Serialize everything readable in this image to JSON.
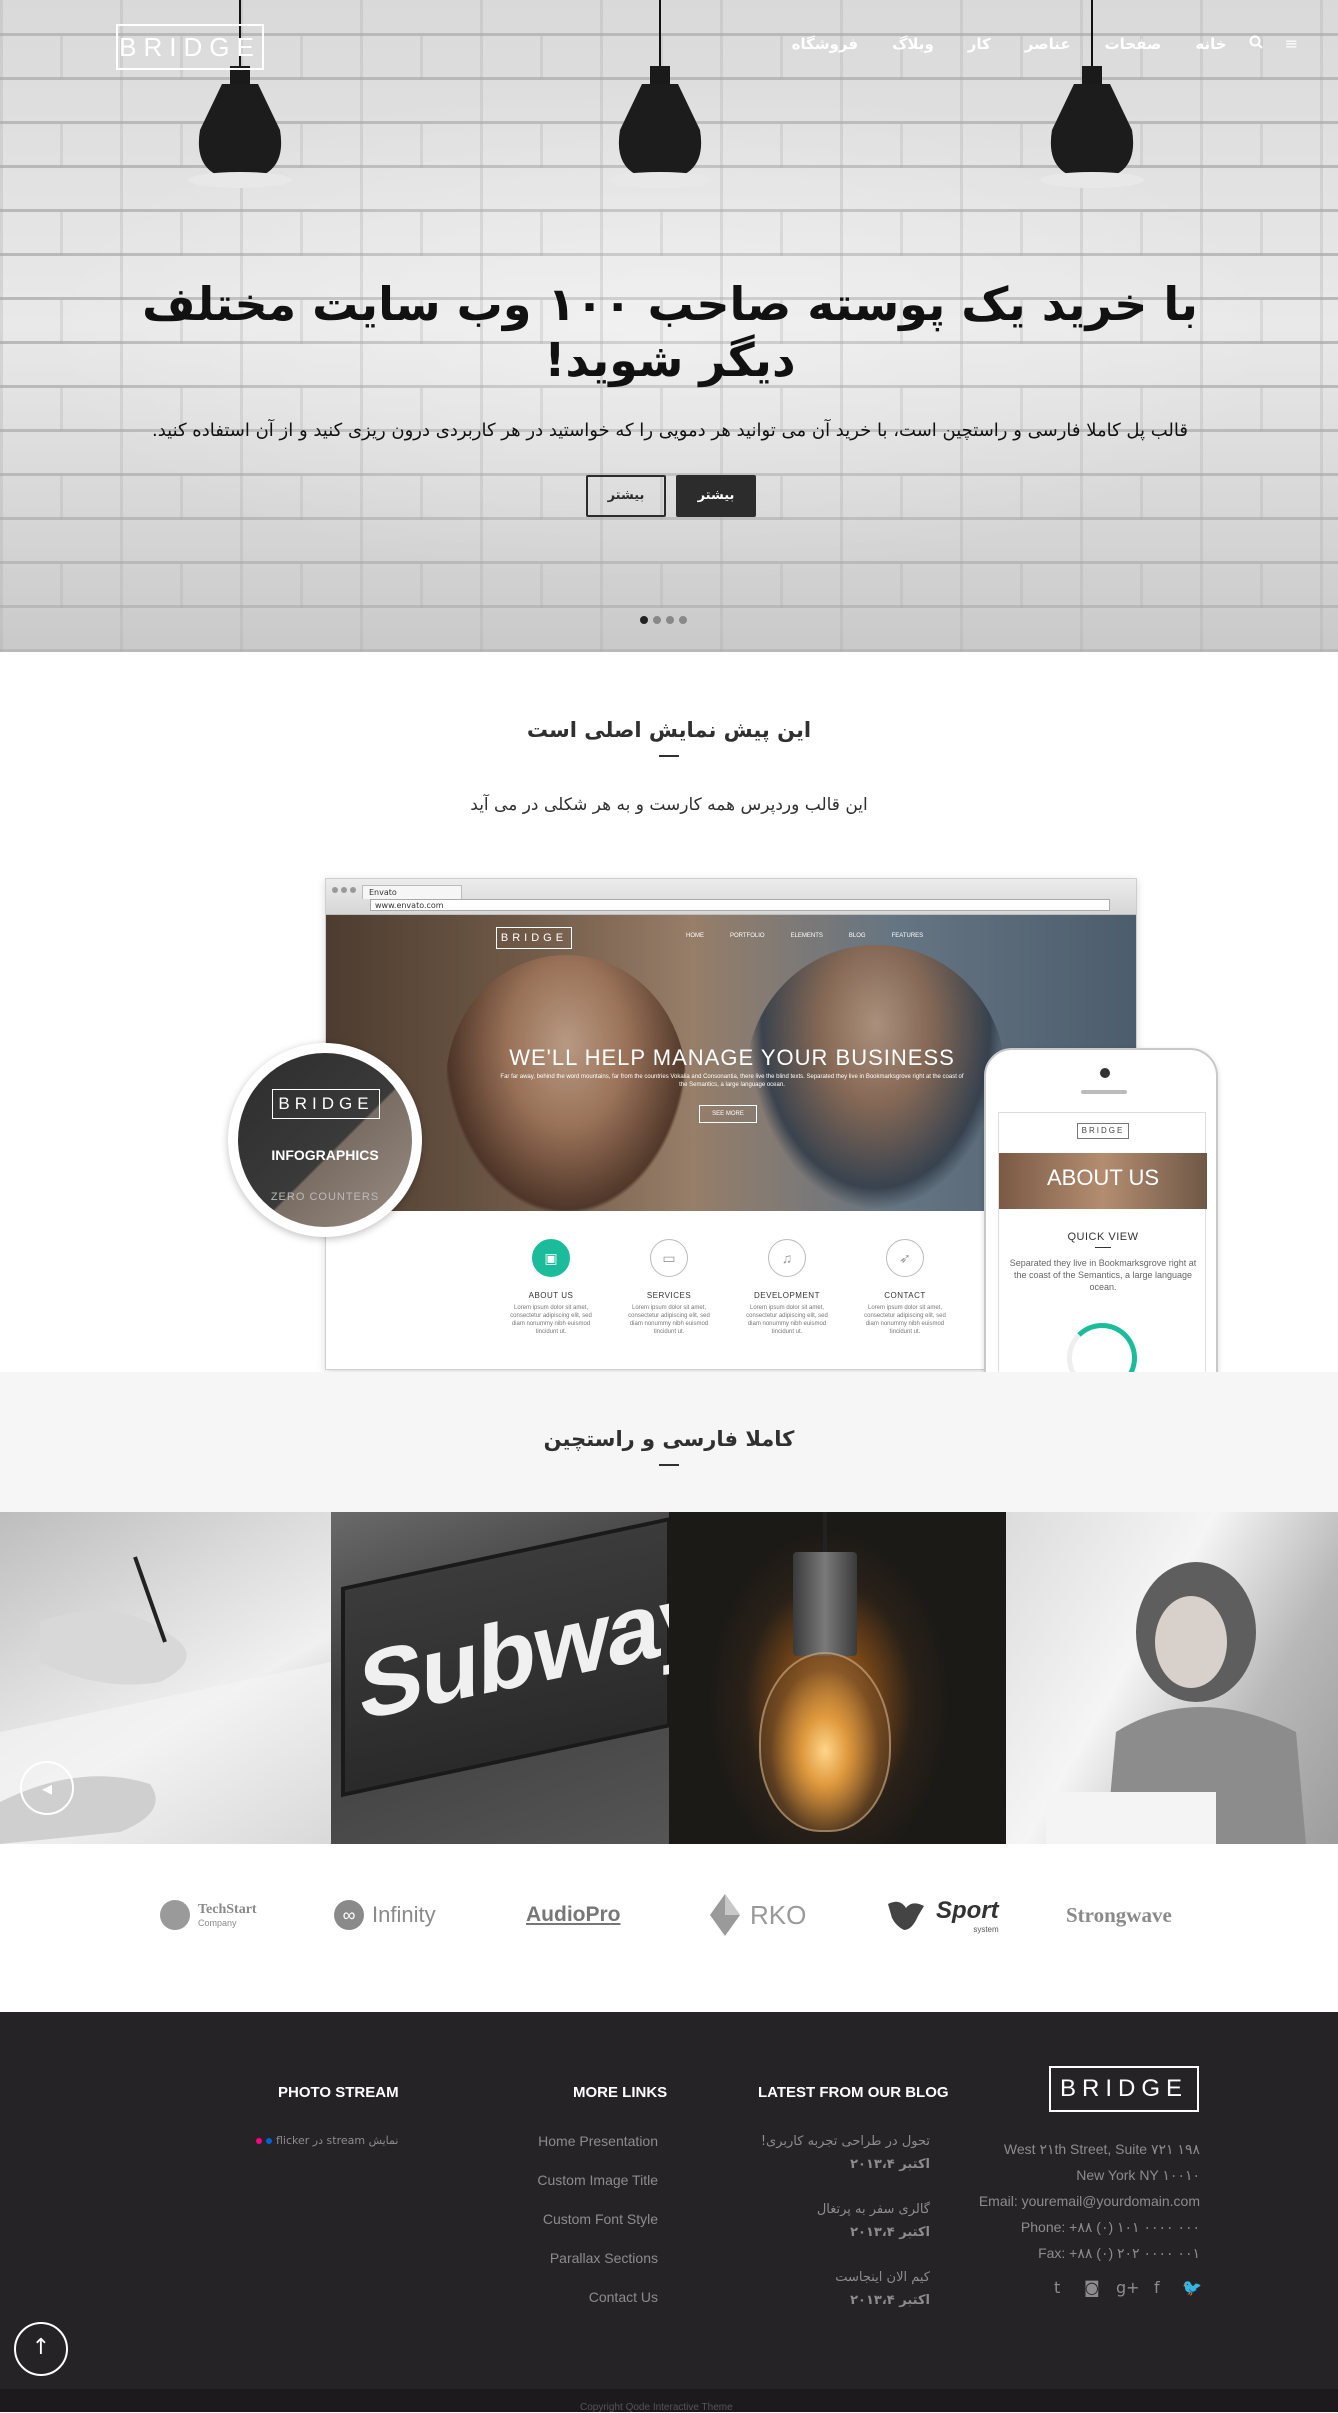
{
  "hero": {
    "logo": "BRIDGE",
    "nav": [
      "خانه",
      "صفحات",
      "عناصر",
      "کار",
      "وبلاگ",
      "فروشگاه"
    ],
    "title": "با خرید یک پوسته صاحب ۱۰۰ وب سایت مختلف دیگر شوید!",
    "subtitle": "قالب پل کاملا فارسی و راستچین است، با خرید آن می توانید هر دمویی را که خواستید در هر کاربردی درون ریزی کنید و از آن استفاده کنید.",
    "buttons": {
      "primary": "بیشتر",
      "secondary": "بیشتر"
    },
    "slides": 4,
    "active_slide": 1
  },
  "section_demo": {
    "title": "این پیش نمایش اصلی است",
    "subtitle": "این قالب وردپرس همه کارست و به هر شکلی در می آید"
  },
  "mockup": {
    "tab_label": "Envato",
    "url": "www.envato.com",
    "logo": "BRIDGE",
    "nav": [
      "HOME",
      "PORTFOLIO",
      "ELEMENTS",
      "BLOG",
      "FEATURES"
    ],
    "headline": "WE'LL HELP MANAGE YOUR BUSINESS",
    "text": "Far far away, behind the word mountains, far from the countries Vokalia and Consonantia, there live the blind texts. Separated they live in Bookmarksgrove right at the coast of the Semantics, a large language ocean.",
    "button": "SEE MORE",
    "services": [
      {
        "label": "ABOUT US",
        "text": "Lorem ipsum dolor sit amet, consectetur adipiscing elit, sed diam nonummy nibh euismod tincidunt ut."
      },
      {
        "label": "SERVICES",
        "text": "Lorem ipsum dolor sit amet, consectetur adipiscing elit, sed diam nonummy nibh euismod tincidunt ut."
      },
      {
        "label": "DEVELOPMENT",
        "text": "Lorem ipsum dolor sit amet, consectetur adipiscing elit, sed diam nonummy nibh euismod tincidunt ut."
      },
      {
        "label": "CONTACT",
        "text": "Lorem ipsum dolor sit amet, consectetur adipiscing elit, sed diam nonummy nibh euismod tincidunt ut."
      }
    ]
  },
  "infographic": {
    "logo": "BRIDGE",
    "title": "INFOGRAPHICS",
    "sub": "ZERO COUNTERS"
  },
  "phone": {
    "logo": "BRIDGE",
    "banner": "ABOUT US",
    "heading": "QUICK VIEW",
    "text": "Separated they live in Bookmarksgrove right at the coast of the Semantics, a large language ocean."
  },
  "section_rtl": {
    "title": "کاملا فارسی و راستچین"
  },
  "photos": {
    "subway_text": "Subway"
  },
  "clients": [
    {
      "name": "TechStart",
      "tag": "Company"
    },
    {
      "name": "Infinity"
    },
    {
      "name": "AudioPro"
    },
    {
      "name": "RKO"
    },
    {
      "name": "Sport",
      "tag": "system"
    },
    {
      "name": "Strongwave"
    }
  ],
  "footer": {
    "logo": "BRIDGE",
    "contact": [
      "West ۲۱th Street, Suite ۷۲۱ ۱۹۸",
      "New York NY ۱۰۰۱۰",
      "Email: youremail@yourdomain.com",
      "Phone: +۸۸ (۰) ۱۰۱ ۰۰۰۰ ۰۰۰",
      "Fax: +۸۸ (۰) ۲۰۲ ۰۰۰۰ ۰۰۱"
    ],
    "blog_heading": "LATEST FROM OUR BLOG",
    "blog": [
      {
        "title": "تحول در طراحی تجربه کاربری!",
        "date": "اکتبر ۲۰۱۳،۴"
      },
      {
        "title": "گالری سفر به پرتغال",
        "date": "اکتبر ۲۰۱۳،۴"
      },
      {
        "title": "کیم الان اینجاست",
        "date": "اکتبر ۲۰۱۳،۴"
      }
    ],
    "links_heading": "MORE LINKS",
    "links": [
      "Home Presentation",
      "Custom Image Title",
      "Custom Font Style",
      "Parallax Sections",
      "Contact Us"
    ],
    "photo_heading": "PHOTO STREAM",
    "flickr_text": "نمایش stream در flicker",
    "copyright": "Copyright Qode Interactive Theme"
  },
  "colors": {
    "accent_green": "#1abc9c",
    "footer_bg": "#262327",
    "dark_button": "#2c2c2c"
  }
}
